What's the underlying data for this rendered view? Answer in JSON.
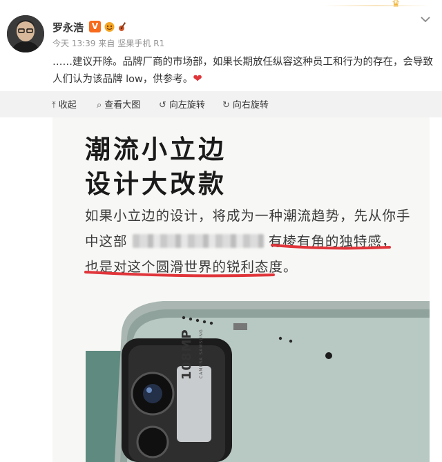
{
  "author": {
    "name": "罗永浩",
    "verified_badge": "V"
  },
  "meta": {
    "time": "今天 13:39",
    "source_prefix": "来自",
    "source": "坚果手机 R1"
  },
  "post": {
    "text": "……建议开除。品牌厂商的市场部，如果长期放任纵容这种员工和行为的存在，会导致人们认为该品牌 low，供参考。",
    "emoji": "❤"
  },
  "toolbar": {
    "collapse_label": "收起",
    "view_large_label": "查看大图",
    "rotate_left_label": "向左旋转",
    "rotate_right_label": "向右旋转",
    "collapse_icon": "collapse-up-icon",
    "view_large_icon": "magnifier-icon",
    "rotate_left_icon": "rotate-left-icon",
    "rotate_right_icon": "rotate-right-icon"
  },
  "ad_image": {
    "headline_line1": "潮流小立边",
    "headline_line2": "设计大改款",
    "body_line1": "如果小立边的设计，将成为一种潮流趋势，先从你手",
    "body_line2_prefix": "中这部",
    "body_line2_suffix": "有棱有角的独特感，",
    "body_line3": "也是对这个圆滑世界的锐利态度。",
    "camera_text": "108MP",
    "camera_subtext": "CAMERA SAMSUNG",
    "accent_color": "#e0353a",
    "phone_color": "#5f8a80"
  },
  "colors": {
    "verified": "#f76b1c",
    "heart": "#e0353a",
    "toolbar_bg": "#f2f2f2"
  }
}
